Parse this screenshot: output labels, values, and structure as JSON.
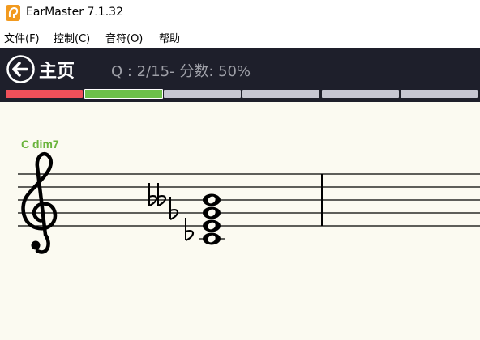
{
  "app": {
    "title": "EarMaster 7.1.32",
    "icon": "earmaster-logo-icon"
  },
  "menu": {
    "items": [
      {
        "label": "文件(F)"
      },
      {
        "label": "控制(C)"
      },
      {
        "label": "音符(O)"
      },
      {
        "label": "帮助"
      }
    ]
  },
  "header": {
    "back_icon": "arrow-left-circle-icon",
    "home_label": "主页",
    "status": "Q : 2/15- 分数: 50%"
  },
  "progress": {
    "segments": [
      {
        "state": "wrong",
        "color": "#f0505a"
      },
      {
        "state": "current",
        "color": "#6cc04a"
      },
      {
        "state": "pending",
        "color": "#c6c6d2"
      },
      {
        "state": "pending",
        "color": "#c6c6d2"
      },
      {
        "state": "pending",
        "color": "#c6c6d2"
      },
      {
        "state": "pending",
        "color": "#c6c6d2"
      }
    ]
  },
  "score": {
    "chord_label": "C dim7",
    "chord_label_color": "#6ab43c",
    "clef": "treble-clef-icon",
    "accidentals": [
      "flat",
      "flat",
      "flat"
    ],
    "notes": 4
  }
}
